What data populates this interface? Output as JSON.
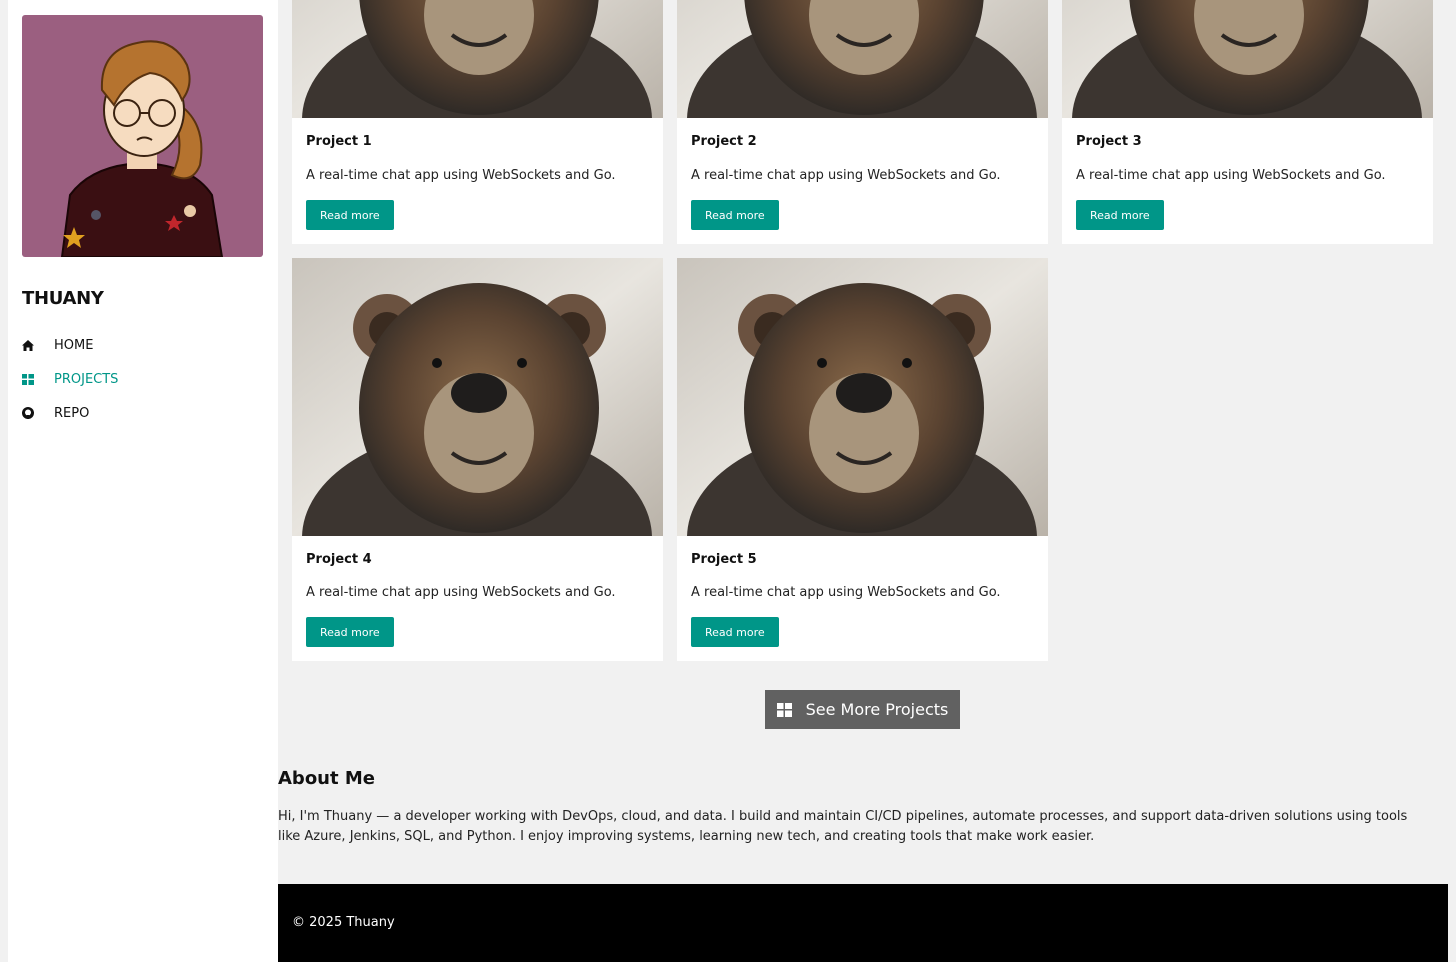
{
  "sidebar": {
    "brand": "THUANY",
    "items": [
      {
        "label": "HOME",
        "icon": "home-icon"
      },
      {
        "label": "PROJECTS",
        "icon": "grid-icon"
      },
      {
        "label": "REPO",
        "icon": "github-icon"
      }
    ]
  },
  "projects": [
    {
      "title": "Project 1",
      "desc": "A real-time chat app using WebSockets and Go.",
      "button": "Read more"
    },
    {
      "title": "Project 2",
      "desc": "A real-time chat app using WebSockets and Go.",
      "button": "Read more"
    },
    {
      "title": "Project 3",
      "desc": "A real-time chat app using WebSockets and Go.",
      "button": "Read more"
    },
    {
      "title": "Project 4",
      "desc": "A real-time chat app using WebSockets and Go.",
      "button": "Read more"
    },
    {
      "title": "Project 5",
      "desc": "A real-time chat app using WebSockets and Go.",
      "button": "Read more"
    }
  ],
  "see_more": "See More Projects",
  "about": {
    "title": "About Me",
    "text": "Hi, I'm Thuany — a developer working with DevOps, cloud, and data. I build and maintain CI/CD pipelines, automate processes, and support data-driven solutions using tools like Azure, Jenkins, SQL, and Python. I enjoy improving systems, learning new tech, and creating tools that make work easier."
  },
  "footer": "© 2025 Thuany",
  "colors": {
    "accent": "#009688",
    "avatar_bg": "#9b5f80",
    "button_dark": "#616161"
  }
}
